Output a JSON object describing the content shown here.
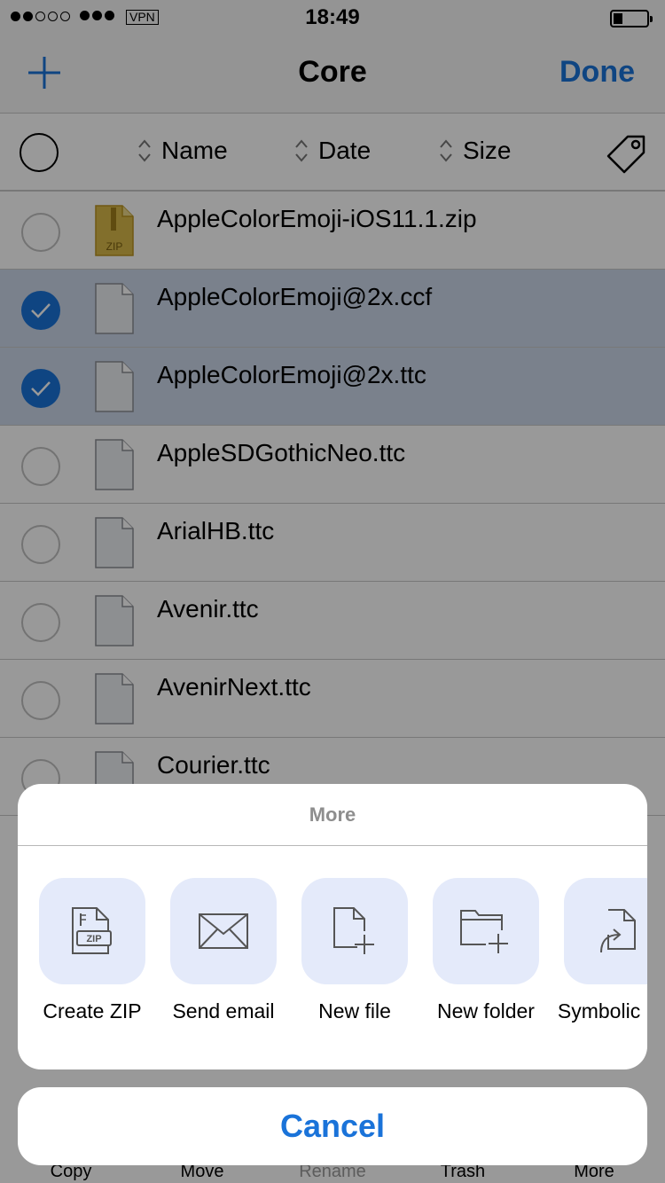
{
  "status_bar": {
    "time": "18:49",
    "vpn": "VPN"
  },
  "nav": {
    "title": "Core",
    "done_label": "Done"
  },
  "header": {
    "name_label": "Name",
    "date_label": "Date",
    "size_label": "Size"
  },
  "files": [
    {
      "name": "AppleColorEmoji-iOS11.1.zip",
      "type": "zip",
      "selected": false
    },
    {
      "name": "AppleColorEmoji@2x.ccf",
      "type": "file",
      "selected": true
    },
    {
      "name": "AppleColorEmoji@2x.ttc",
      "type": "file",
      "selected": true
    },
    {
      "name": "AppleSDGothicNeo.ttc",
      "type": "file",
      "selected": false
    },
    {
      "name": "ArialHB.ttc",
      "type": "file",
      "selected": false
    },
    {
      "name": "Avenir.ttc",
      "type": "file",
      "selected": false
    },
    {
      "name": "AvenirNext.ttc",
      "type": "file",
      "selected": false
    },
    {
      "name": "Courier.ttc",
      "type": "file",
      "selected": false
    }
  ],
  "toolbar": {
    "copy": "Copy",
    "move": "Move",
    "rename": "Rename",
    "trash": "Trash",
    "more": "More"
  },
  "sheet": {
    "title": "More",
    "actions": [
      {
        "label": "Create ZIP",
        "icon": "zip-icon"
      },
      {
        "label": "Send email",
        "icon": "envelope-icon"
      },
      {
        "label": "New file",
        "icon": "new-file-icon"
      },
      {
        "label": "New folder",
        "icon": "new-folder-icon"
      },
      {
        "label": "Symbolic link",
        "icon": "symlink-icon"
      }
    ],
    "cancel_label": "Cancel"
  },
  "colors": {
    "accent": "#1a73d9",
    "selected_row": "#cbd7ea",
    "tile": "#e4eafa"
  }
}
